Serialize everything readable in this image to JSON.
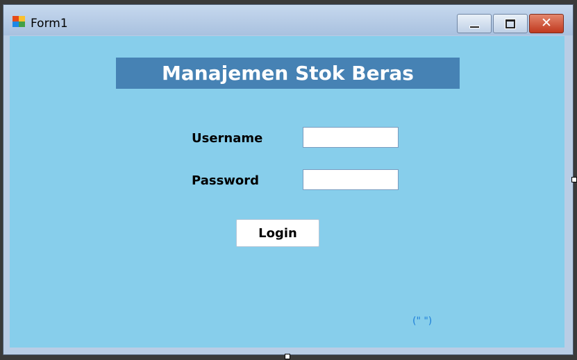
{
  "window": {
    "title": "Form1",
    "icon": "windows-form-icon",
    "controls": {
      "minimize": "minimize-icon",
      "maximize": "maximize-icon",
      "close": "close-icon"
    },
    "close_glyph": "✕"
  },
  "form": {
    "heading": "Manajemen Stok Beras",
    "username_label": "Username",
    "username_value": "",
    "password_label": "Password",
    "password_value": "",
    "login_label": "Login",
    "status_text": "(\" \")"
  },
  "colors": {
    "client_background": "#87ceeb",
    "banner_background": "#4682b4",
    "status_text": "#1e7fd8"
  }
}
